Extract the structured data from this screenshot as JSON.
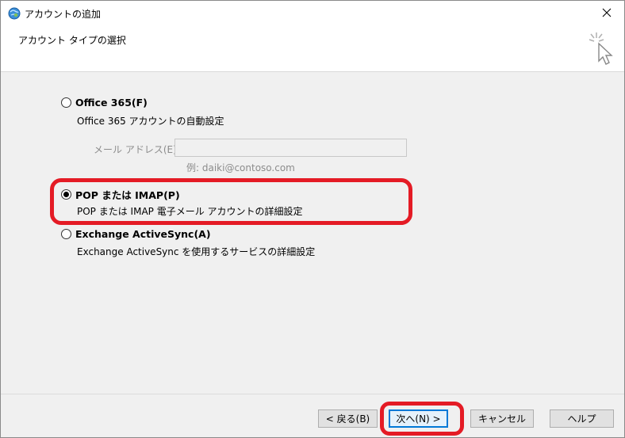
{
  "window": {
    "title": "アカウントの追加"
  },
  "header": {
    "title": "アカウント タイプの選択"
  },
  "options": [
    {
      "label": "Office 365(F)",
      "description": "Office 365 アカウントの自動設定",
      "selected": false
    },
    {
      "label": "POP または IMAP(P)",
      "description": "POP または IMAP 電子メール アカウントの詳細設定",
      "selected": true
    },
    {
      "label": "Exchange ActiveSync(A)",
      "description": "Exchange ActiveSync を使用するサービスの詳細設定",
      "selected": false
    }
  ],
  "email": {
    "label": "メール アドレス(E):",
    "value": "",
    "example": "例: daiki@contoso.com"
  },
  "buttons": {
    "back": "< 戻る(B)",
    "next": "次へ(N) >",
    "cancel": "キャンセル",
    "help": "ヘルプ"
  },
  "colors": {
    "highlight": "#e41b25",
    "accent": "#0078d7"
  }
}
